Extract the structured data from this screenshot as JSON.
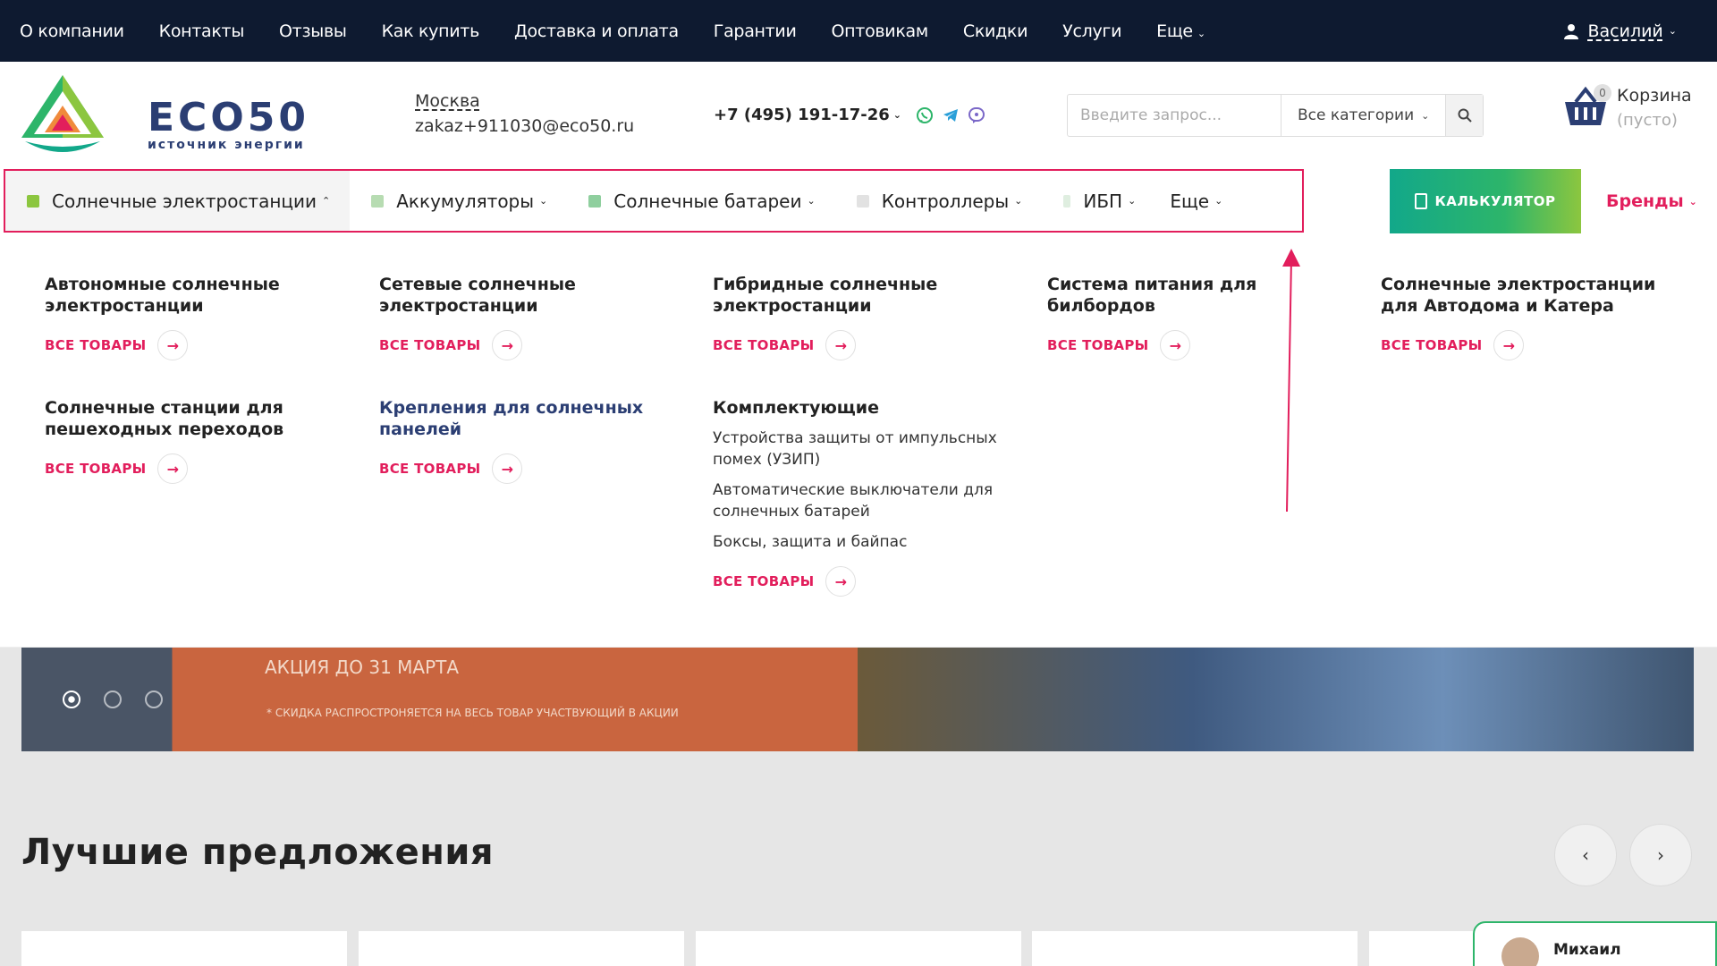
{
  "topnav": {
    "items": [
      "О компании",
      "Контакты",
      "Отзывы",
      "Как купить",
      "Доставка и оплата",
      "Гарантии",
      "Оптовикам",
      "Скидки",
      "Услуги",
      "Еще"
    ],
    "user": "Василий"
  },
  "logo": {
    "name": "ECO50",
    "tagline": "источник энергии"
  },
  "contacts": {
    "city": "Москва",
    "email": "zakaz+911030@eco50.ru",
    "phone": "+7 (495) 191-17-26"
  },
  "search": {
    "placeholder": "Введите запрос...",
    "category": "Все категории"
  },
  "cart": {
    "label": "Корзина",
    "status": "(пусто)",
    "count": "0"
  },
  "catnav": {
    "items": [
      "Солнечные электростанции",
      "Аккумуляторы",
      "Солнечные батареи",
      "Контроллеры",
      "ИБП",
      "Еще"
    ],
    "calculator": "КАЛЬКУЛЯТОР",
    "brands": "Бренды"
  },
  "mega": {
    "all_label": "ВСЕ ТОВАРЫ",
    "items": [
      {
        "title": "Автономные солнечные электростанции"
      },
      {
        "title": "Сетевые солнечные электростанции"
      },
      {
        "title": "Гибридные солнечные электростанции"
      },
      {
        "title": "Система питания для билбордов"
      },
      {
        "title": "Солнечные электростанции для Автодома и Катера"
      },
      {
        "title": "Солнечные станции для пешеходных переходов"
      },
      {
        "title": "Крепления для солнечных панелей"
      },
      {
        "title": "Комплектующие",
        "subs": [
          "Устройства защиты от импульсных помех (УЗИП)",
          "Автоматические выключатели для солнечных батарей",
          "Боксы, защита и байпас"
        ]
      }
    ]
  },
  "banner": {
    "title": "АКЦИЯ ДО 31 МАРТА",
    "note": "* СКИДКА РАСПРОСТРОНЯЕТСЯ НА ВЕСЬ ТОВАР УЧАСТВУЮЩИЙ В АКЦИИ"
  },
  "offers": {
    "title": "Лучшие предложения"
  },
  "chat": {
    "name": "Михаил"
  },
  "colors": {
    "accent": "#e21e5c",
    "dark": "#0e1a30",
    "brand": "#2b3e73",
    "green": "#2db56a"
  },
  "icons": [
    "user-icon",
    "chevron-down-icon",
    "whatsapp-icon",
    "telegram-icon",
    "viber-icon",
    "search-icon",
    "basket-icon",
    "calculator-icon",
    "arrow-right-icon",
    "chevron-left-icon",
    "chevron-right-icon"
  ]
}
